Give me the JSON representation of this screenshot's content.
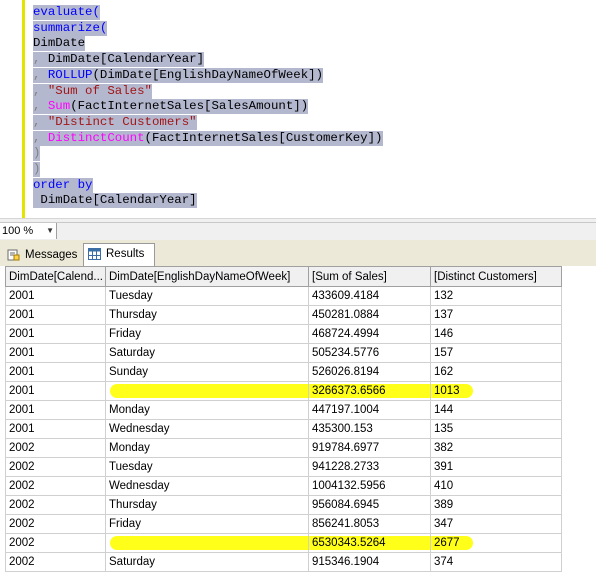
{
  "editor": {
    "lines": [
      [
        {
          "t": "evaluate(",
          "c": "kw"
        }
      ],
      [
        {
          "t": "summarize(",
          "c": "kw"
        }
      ],
      [
        {
          "t": "DimDate",
          "c": ""
        }
      ],
      [
        {
          "t": ", ",
          "c": "op"
        },
        {
          "t": "DimDate[CalendarYear]",
          "c": ""
        }
      ],
      [
        {
          "t": ", ",
          "c": "op"
        },
        {
          "t": "ROLLUP",
          "c": "kw"
        },
        {
          "t": "(DimDate[EnglishDayNameOfWeek])",
          "c": ""
        }
      ],
      [
        {
          "t": ", ",
          "c": "op"
        },
        {
          "t": "\"Sum of Sales\"",
          "c": "str"
        }
      ],
      [
        {
          "t": ", ",
          "c": "op"
        },
        {
          "t": "Sum",
          "c": "fn"
        },
        {
          "t": "(FactInternetSales[SalesAmount])",
          "c": ""
        }
      ],
      [
        {
          "t": ", ",
          "c": "op"
        },
        {
          "t": "\"Distinct Customers\"",
          "c": "str"
        }
      ],
      [
        {
          "t": ", ",
          "c": "op"
        },
        {
          "t": "DistinctCount",
          "c": "fn"
        },
        {
          "t": "(FactInternetSales[CustomerKey])",
          "c": ""
        }
      ],
      [
        {
          "t": ")",
          "c": "op"
        }
      ],
      [
        {
          "t": ")",
          "c": "op"
        }
      ],
      [
        {
          "t": "order by",
          "c": "kw"
        }
      ],
      [
        {
          "t": " DimDate[CalendarYear]",
          "c": ""
        }
      ]
    ]
  },
  "zoom": {
    "value": "100 %"
  },
  "tabs": {
    "messages": "Messages",
    "results": "Results"
  },
  "grid": {
    "columns": [
      "DimDate[Calend...",
      "DimDate[EnglishDayNameOfWeek]",
      "[Sum of Sales]",
      "[Distinct Customers]"
    ],
    "rows": [
      [
        "2001",
        "Tuesday",
        "433609.4184",
        "132"
      ],
      [
        "2001",
        "Thursday",
        "450281.0884",
        "137"
      ],
      [
        "2001",
        "Friday",
        "468724.4994",
        "146"
      ],
      [
        "2001",
        "Saturday",
        "505234.5776",
        "157"
      ],
      [
        "2001",
        "Sunday",
        "526026.8194",
        "162"
      ],
      [
        "2001",
        "",
        "3266373.6566",
        "1013"
      ],
      [
        "2001",
        "Monday",
        "447197.1004",
        "144"
      ],
      [
        "2001",
        "Wednesday",
        "435300.153",
        "135"
      ],
      [
        "2002",
        "Monday",
        "919784.6977",
        "382"
      ],
      [
        "2002",
        "Tuesday",
        "941228.2733",
        "391"
      ],
      [
        "2002",
        "Wednesday",
        "1004132.5956",
        "410"
      ],
      [
        "2002",
        "Thursday",
        "956084.6945",
        "389"
      ],
      [
        "2002",
        "Friday",
        "856241.8053",
        "347"
      ],
      [
        "2002",
        "",
        "6530343.5264",
        "2677"
      ],
      [
        "2002",
        "Saturday",
        "915346.1904",
        "374"
      ]
    ],
    "highlighted_rows": [
      5,
      13
    ],
    "highlight_color": "#ffff00"
  }
}
